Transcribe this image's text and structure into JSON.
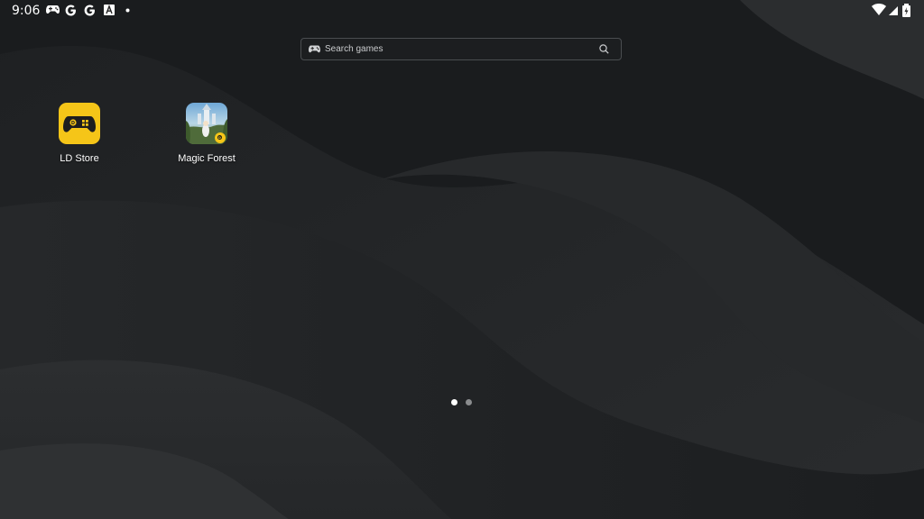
{
  "status_bar": {
    "time": "9:06",
    "notification_icons": [
      "gamepad-icon",
      "google-icon",
      "google-icon",
      "store-a-icon",
      "dot-icon"
    ],
    "system_icons": [
      "wifi-icon",
      "cell-signal-icon",
      "battery-icon"
    ]
  },
  "search": {
    "label": "Search games",
    "left_icon": "gamepad-icon",
    "right_icon": "search-icon"
  },
  "apps": [
    {
      "label": "LD Store",
      "icon": "ld-store-icon",
      "color": "#F5C518"
    },
    {
      "label": "Magic Forest",
      "icon": "magic-forest-icon"
    }
  ],
  "page_indicator": {
    "count": 2,
    "active": 0,
    "active_color": "#FFFFFF",
    "inactive_color": "#8A8C8E"
  },
  "colors": {
    "wallpaper_base": "#222426",
    "accent_yellow": "#F5C518"
  }
}
